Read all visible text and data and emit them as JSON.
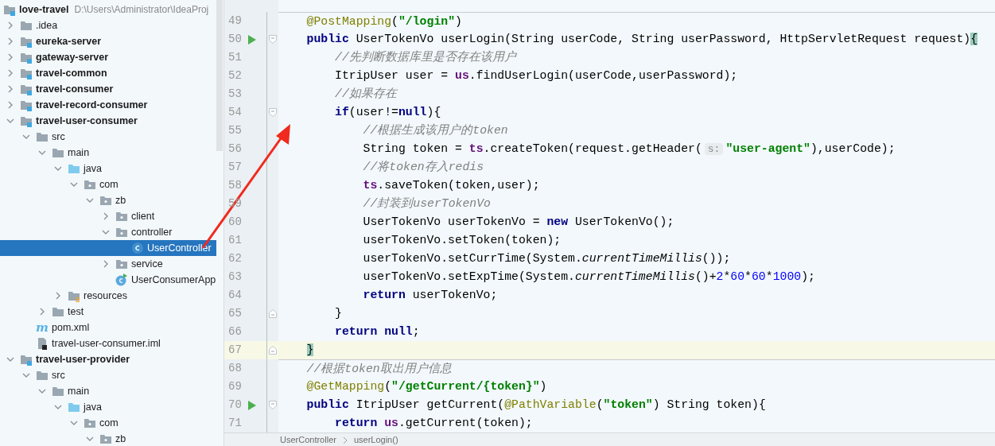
{
  "project_tree": {
    "label": "love-travel",
    "kind": "project",
    "path": "D:\\Users\\Administrator\\IdeaProj",
    "selected": false,
    "children": [
      {
        "label": ".idea",
        "kind": "folder",
        "expanded": false,
        "selected": false
      },
      {
        "label": "eureka-server",
        "kind": "module",
        "expanded": false,
        "selected": false
      },
      {
        "label": "gateway-server",
        "kind": "module",
        "expanded": false,
        "selected": false
      },
      {
        "label": "travel-common",
        "kind": "module",
        "expanded": false,
        "selected": false
      },
      {
        "label": "travel-consumer",
        "kind": "module",
        "expanded": false,
        "selected": false
      },
      {
        "label": "travel-record-consumer",
        "kind": "module",
        "expanded": false,
        "selected": false
      },
      {
        "label": "travel-user-consumer",
        "kind": "module",
        "expanded": true,
        "selected": false,
        "children": [
          {
            "label": "src",
            "kind": "folder",
            "expanded": true,
            "selected": false,
            "children": [
              {
                "label": "main",
                "kind": "folder",
                "expanded": true,
                "selected": false,
                "children": [
                  {
                    "label": "java",
                    "kind": "source",
                    "expanded": true,
                    "selected": false,
                    "children": [
                      {
                        "label": "com",
                        "kind": "package",
                        "expanded": true,
                        "selected": false,
                        "children": [
                          {
                            "label": "zb",
                            "kind": "package",
                            "expanded": true,
                            "selected": false,
                            "children": [
                              {
                                "label": "client",
                                "kind": "package",
                                "expanded": false,
                                "selected": false
                              },
                              {
                                "label": "controller",
                                "kind": "package",
                                "expanded": true,
                                "selected": false,
                                "children": [
                                  {
                                    "label": "UserController",
                                    "kind": "class",
                                    "selected": true
                                  }
                                ]
                              },
                              {
                                "label": "service",
                                "kind": "package",
                                "expanded": false,
                                "selected": false
                              },
                              {
                                "label": "UserConsumerApp",
                                "kind": "app",
                                "selected": false
                              }
                            ]
                          }
                        ]
                      }
                    ]
                  },
                  {
                    "label": "resources",
                    "kind": "resources",
                    "expanded": false,
                    "selected": false
                  }
                ]
              },
              {
                "label": "test",
                "kind": "folder",
                "expanded": false,
                "selected": false
              }
            ]
          },
          {
            "label": "pom.xml",
            "kind": "maven",
            "icon_glyph": "m",
            "selected": false
          },
          {
            "label": "travel-user-consumer.iml",
            "kind": "iml",
            "selected": false
          }
        ]
      },
      {
        "label": "travel-user-provider",
        "kind": "module",
        "expanded": true,
        "selected": false,
        "children": [
          {
            "label": "src",
            "kind": "folder",
            "expanded": true,
            "selected": false,
            "children": [
              {
                "label": "main",
                "kind": "folder",
                "expanded": true,
                "selected": false,
                "children": [
                  {
                    "label": "java",
                    "kind": "source",
                    "expanded": true,
                    "selected": false,
                    "children": [
                      {
                        "label": "com",
                        "kind": "package",
                        "expanded": true,
                        "selected": false,
                        "children": [
                          {
                            "label": "zb",
                            "kind": "package",
                            "expanded": true,
                            "selected": false
                          }
                        ]
                      }
                    ]
                  }
                ]
              }
            ]
          }
        ]
      }
    ]
  },
  "editor": {
    "lines": [
      {
        "number": "49",
        "separator_above": true,
        "current": false,
        "tokens": [
          {
            "kind": "annotation",
            "text": "    @PostMapping"
          },
          {
            "kind": "plain",
            "text": "("
          },
          {
            "kind": "string",
            "text": "\"/login\""
          },
          {
            "kind": "plain",
            "text": ")"
          }
        ]
      },
      {
        "number": "50",
        "gutter_icons": [
          {
            "kind": "run"
          },
          {
            "kind": "fold-start"
          }
        ],
        "separator_above": false,
        "current": false,
        "tokens": [
          {
            "kind": "keyword",
            "text": "    public"
          },
          {
            "kind": "plain",
            "text": " UserTokenVo userLogin(String userCode, String userPassword, HttpServletRequest request)"
          },
          {
            "kind": "brace-match",
            "text": "{"
          }
        ]
      },
      {
        "number": "51",
        "separator_above": false,
        "current": false,
        "tokens": [
          {
            "kind": "comment",
            "text": "        //先判断数据库里是否存在该用户"
          }
        ]
      },
      {
        "number": "52",
        "separator_above": false,
        "current": false,
        "tokens": [
          {
            "kind": "plain",
            "text": "        ItripUser user = "
          },
          {
            "kind": "field",
            "text": "us"
          },
          {
            "kind": "plain",
            "text": ".findUserLogin(userCode,userPassword);"
          }
        ]
      },
      {
        "number": "53",
        "separator_above": false,
        "current": false,
        "tokens": [
          {
            "kind": "comment",
            "text": "        //如果存在"
          }
        ]
      },
      {
        "number": "54",
        "gutter_icons": [
          {
            "kind": "fold-start"
          }
        ],
        "separator_above": false,
        "current": false,
        "tokens": [
          {
            "kind": "keyword",
            "text": "        if"
          },
          {
            "kind": "plain",
            "text": "(user!="
          },
          {
            "kind": "keyword",
            "text": "null"
          },
          {
            "kind": "plain",
            "text": "){"
          }
        ]
      },
      {
        "number": "55",
        "separator_above": false,
        "current": false,
        "tokens": [
          {
            "kind": "comment",
            "text": "            //根据生成该用户的token"
          }
        ]
      },
      {
        "number": "56",
        "separator_above": false,
        "current": false,
        "tokens": [
          {
            "kind": "plain",
            "text": "            String token = "
          },
          {
            "kind": "field",
            "text": "ts"
          },
          {
            "kind": "plain",
            "text": ".createToken(request.getHeader("
          },
          {
            "kind": "hint",
            "text": "s:"
          },
          {
            "kind": "string",
            "text": "\"user-agent\""
          },
          {
            "kind": "plain",
            "text": "),userCode);"
          }
        ]
      },
      {
        "number": "57",
        "separator_above": false,
        "current": false,
        "tokens": [
          {
            "kind": "comment",
            "text": "            //将token存入redis"
          }
        ]
      },
      {
        "number": "58",
        "separator_above": false,
        "current": false,
        "tokens": [
          {
            "kind": "field",
            "text": "            ts"
          },
          {
            "kind": "plain",
            "text": ".saveToken(token,user);"
          }
        ]
      },
      {
        "number": "59",
        "separator_above": false,
        "current": false,
        "tokens": [
          {
            "kind": "comment",
            "text": "            //封装到userTokenVo"
          }
        ]
      },
      {
        "number": "60",
        "separator_above": false,
        "current": false,
        "tokens": [
          {
            "kind": "plain",
            "text": "            UserTokenVo userTokenVo = "
          },
          {
            "kind": "keyword",
            "text": "new"
          },
          {
            "kind": "plain",
            "text": " UserTokenVo();"
          }
        ]
      },
      {
        "number": "61",
        "separator_above": false,
        "current": false,
        "tokens": [
          {
            "kind": "plain",
            "text": "            userTokenVo.setToken(token);"
          }
        ]
      },
      {
        "number": "62",
        "separator_above": false,
        "current": false,
        "tokens": [
          {
            "kind": "plain",
            "text": "            userTokenVo.setCurrTime(System."
          },
          {
            "kind": "static",
            "text": "currentTimeMillis"
          },
          {
            "kind": "plain",
            "text": "());"
          }
        ]
      },
      {
        "number": "63",
        "separator_above": false,
        "current": false,
        "tokens": [
          {
            "kind": "plain",
            "text": "            userTokenVo.setExpTime(System."
          },
          {
            "kind": "static",
            "text": "currentTimeMillis"
          },
          {
            "kind": "plain",
            "text": "()+"
          },
          {
            "kind": "number",
            "text": "2"
          },
          {
            "kind": "plain",
            "text": "*"
          },
          {
            "kind": "number",
            "text": "60"
          },
          {
            "kind": "plain",
            "text": "*"
          },
          {
            "kind": "number",
            "text": "60"
          },
          {
            "kind": "plain",
            "text": "*"
          },
          {
            "kind": "number",
            "text": "1000"
          },
          {
            "kind": "plain",
            "text": ");"
          }
        ]
      },
      {
        "number": "64",
        "separator_above": false,
        "current": false,
        "tokens": [
          {
            "kind": "keyword",
            "text": "            return"
          },
          {
            "kind": "plain",
            "text": " userTokenVo;"
          }
        ]
      },
      {
        "number": "65",
        "gutter_icons": [
          {
            "kind": "fold-end"
          }
        ],
        "separator_above": false,
        "current": false,
        "tokens": [
          {
            "kind": "plain",
            "text": "        }"
          }
        ]
      },
      {
        "number": "66",
        "separator_above": false,
        "current": false,
        "tokens": [
          {
            "kind": "keyword",
            "text": "        return null"
          },
          {
            "kind": "plain",
            "text": ";"
          }
        ]
      },
      {
        "number": "67",
        "gutter_icons": [
          {
            "kind": "fold-end"
          }
        ],
        "separator_above": false,
        "current": true,
        "tokens": [
          {
            "kind": "brace-match",
            "text": "    }"
          }
        ]
      },
      {
        "number": "68",
        "separator_above": true,
        "current": false,
        "tokens": [
          {
            "kind": "comment",
            "text": "    //根据token取出用户信息"
          }
        ]
      },
      {
        "number": "69",
        "separator_above": false,
        "current": false,
        "tokens": [
          {
            "kind": "annotation",
            "text": "    @GetMapping"
          },
          {
            "kind": "plain",
            "text": "("
          },
          {
            "kind": "string",
            "text": "\"/getCurrent/{token}\""
          },
          {
            "kind": "plain",
            "text": ")"
          }
        ]
      },
      {
        "number": "70",
        "gutter_icons": [
          {
            "kind": "run"
          },
          {
            "kind": "fold-start"
          }
        ],
        "separator_above": false,
        "current": false,
        "tokens": [
          {
            "kind": "keyword",
            "text": "    public"
          },
          {
            "kind": "plain",
            "text": " ItripUser getCurrent("
          },
          {
            "kind": "annotation",
            "text": "@PathVariable"
          },
          {
            "kind": "plain",
            "text": "("
          },
          {
            "kind": "string",
            "text": "\"token\""
          },
          {
            "kind": "plain",
            "text": ") String token){"
          }
        ]
      },
      {
        "number": "71",
        "separator_above": false,
        "current": false,
        "tokens": [
          {
            "kind": "keyword",
            "text": "        return"
          },
          {
            "kind": "field",
            "text": " us"
          },
          {
            "kind": "plain",
            "text": ".getCurrent(token);"
          }
        ]
      }
    ],
    "breadcrumbs": [
      "UserController",
      "userLogin()"
    ]
  }
}
